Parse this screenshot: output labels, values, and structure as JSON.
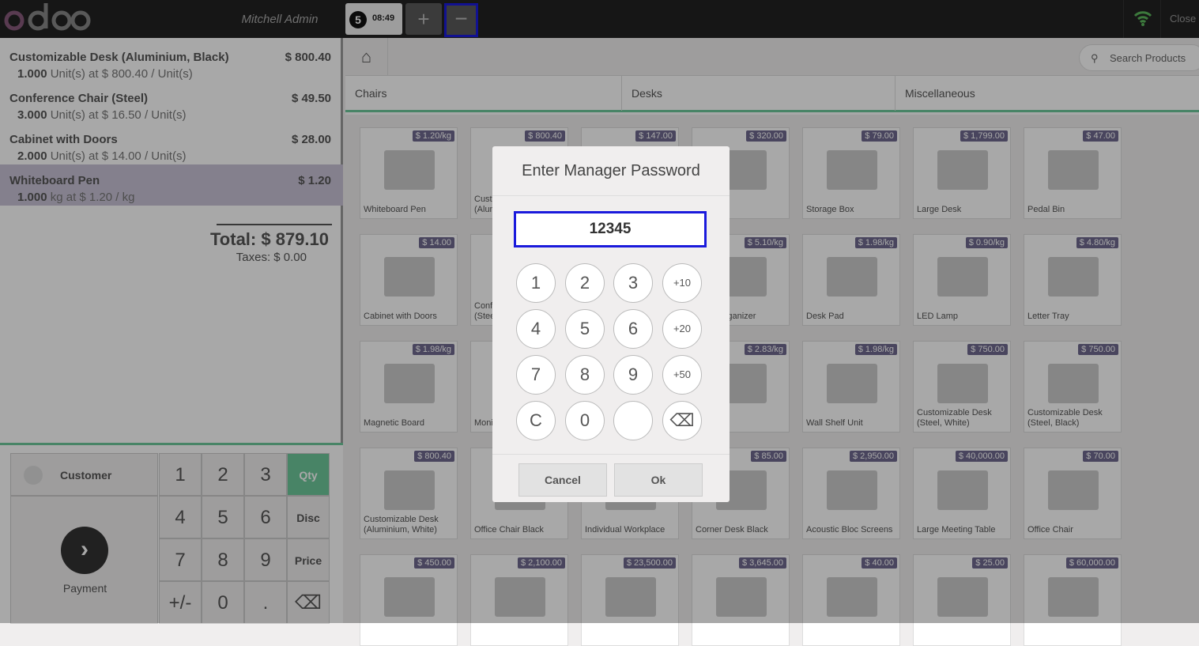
{
  "topbar": {
    "logo_text": "odoo",
    "user": "Mitchell Admin",
    "order_number": "5",
    "order_time": "08:49",
    "add_order": "+",
    "delete_order": "−",
    "close": "Close",
    "wifi_icon": "wifi-icon",
    "wifi_color": "#5cb85c"
  },
  "order": {
    "lines": [
      {
        "name": "Customizable Desk (Aluminium, Black)",
        "price": "$ 800.40",
        "qty": "1.000",
        "detail": "Unit(s) at $ 800.40 / Unit(s)"
      },
      {
        "name": "Conference Chair (Steel)",
        "price": "$ 49.50",
        "qty": "3.000",
        "detail": "Unit(s) at $ 16.50 / Unit(s)"
      },
      {
        "name": "Cabinet with Doors",
        "price": "$ 28.00",
        "qty": "2.000",
        "detail": "Unit(s) at $ 14.00 / Unit(s)"
      },
      {
        "name": "Whiteboard Pen",
        "price": "$ 1.20",
        "qty": "1.000",
        "detail": "kg at $ 1.20 / kg"
      }
    ],
    "total": "Total: $ 879.10",
    "taxes": "Taxes: $ 0.00"
  },
  "pad": {
    "customer": "Customer",
    "payment": "Payment",
    "keys": [
      "1",
      "2",
      "3",
      "Qty",
      "4",
      "5",
      "6",
      "Disc",
      "7",
      "8",
      "9",
      "Price",
      "+/-",
      "0",
      ".",
      "⌫"
    ]
  },
  "products_area": {
    "home_icon": "home-icon",
    "search_placeholder": "Search Products",
    "categories": [
      "Chairs",
      "Desks",
      "Miscellaneous"
    ],
    "products": [
      {
        "name": "Whiteboard Pen",
        "price": "$ 1.20/kg"
      },
      {
        "name": "Customizable Desk (Aluminium, Black)",
        "price": "$ 800.40"
      },
      {
        "name": "",
        "price": "$ 147.00"
      },
      {
        "name": "Cabinet",
        "price": "$ 320.00"
      },
      {
        "name": "Storage Box",
        "price": "$ 79.00"
      },
      {
        "name": "Large Desk",
        "price": "$ 1,799.00"
      },
      {
        "name": "Pedal Bin",
        "price": "$ 47.00"
      },
      {
        "name": "Cabinet with Doors",
        "price": "$ 14.00"
      },
      {
        "name": "Conference Chair (Steel)",
        "price": ""
      },
      {
        "name": "",
        "price": ""
      },
      {
        "name": "Desk Organizer",
        "price": "$ 5.10/kg"
      },
      {
        "name": "Desk Pad",
        "price": "$ 1.98/kg"
      },
      {
        "name": "LED Lamp",
        "price": "$ 0.90/kg"
      },
      {
        "name": "Letter Tray",
        "price": "$ 4.80/kg"
      },
      {
        "name": "Magnetic Board",
        "price": "$ 1.98/kg"
      },
      {
        "name": "Monitor Stand",
        "price": ""
      },
      {
        "name": "",
        "price": ""
      },
      {
        "name": "Shelf",
        "price": "$ 2.83/kg"
      },
      {
        "name": "Wall Shelf Unit",
        "price": "$ 1.98/kg"
      },
      {
        "name": "Customizable Desk (Steel, White)",
        "price": "$ 750.00"
      },
      {
        "name": "Customizable Desk (Steel, Black)",
        "price": "$ 750.00"
      },
      {
        "name": "Customizable Desk (Aluminium, White)",
        "price": "$ 800.40"
      },
      {
        "name": "Office Chair Black",
        "price": ""
      },
      {
        "name": "Individual Workplace",
        "price": ""
      },
      {
        "name": "Corner Desk Black",
        "price": "$ 85.00"
      },
      {
        "name": "Acoustic Bloc Screens",
        "price": "$ 2,950.00"
      },
      {
        "name": "Large Meeting Table",
        "price": "$ 40,000.00"
      },
      {
        "name": "Office Chair",
        "price": "$ 70.00"
      },
      {
        "name": "",
        "price": "$ 450.00"
      },
      {
        "name": "",
        "price": "$ 2,100.00"
      },
      {
        "name": "",
        "price": "$ 23,500.00"
      },
      {
        "name": "",
        "price": "$ 3,645.00"
      },
      {
        "name": "",
        "price": "$ 40.00"
      },
      {
        "name": "",
        "price": "$ 25.00"
      },
      {
        "name": "",
        "price": "$ 60,000.00"
      }
    ]
  },
  "modal": {
    "title": "Enter Manager Password",
    "value": "12345",
    "keys": [
      "1",
      "2",
      "3",
      "+10",
      "4",
      "5",
      "6",
      "+20",
      "7",
      "8",
      "9",
      "+50",
      "C",
      "0",
      "",
      "⌫"
    ],
    "cancel": "Cancel",
    "ok": "Ok"
  }
}
